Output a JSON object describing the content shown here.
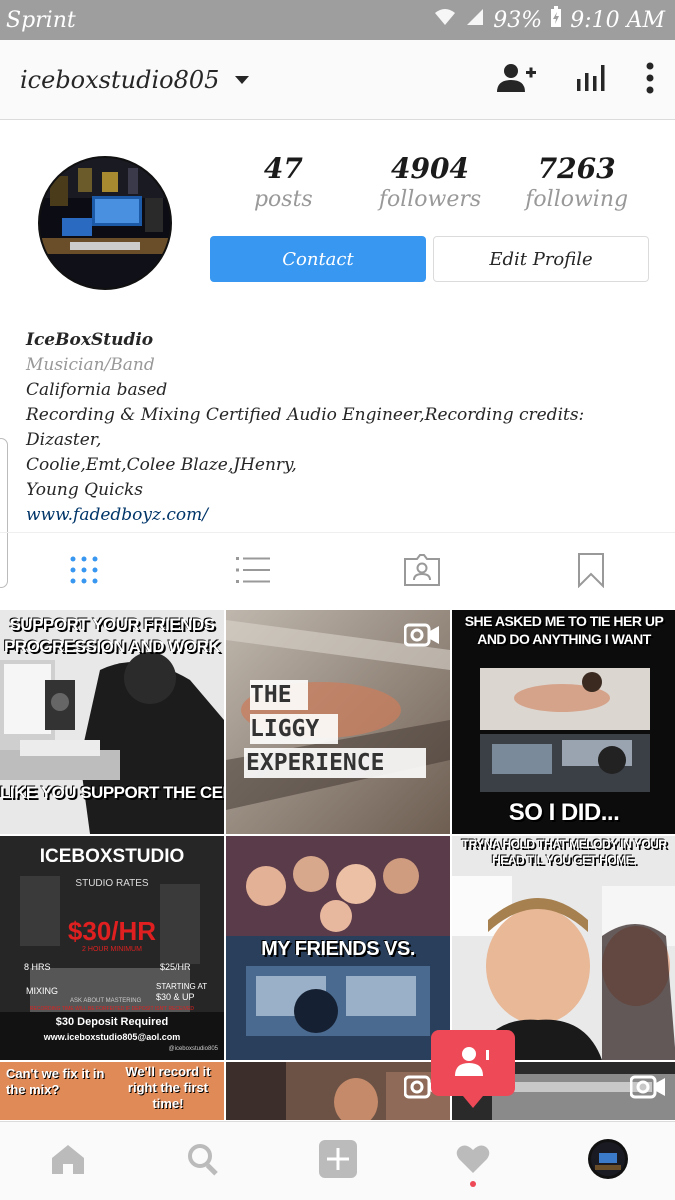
{
  "status_bar": {
    "carrier": "Sprint",
    "battery": "93%",
    "time": "9:10 AM"
  },
  "header": {
    "username": "iceboxstudio805",
    "icons": [
      "add-user-icon",
      "insights-icon",
      "more-options-icon"
    ]
  },
  "profile": {
    "stats": [
      {
        "value": "47",
        "label": "posts"
      },
      {
        "value": "4904",
        "label": "followers"
      },
      {
        "value": "7263",
        "label": "following"
      }
    ],
    "contact_label": "Contact",
    "edit_label": "Edit Profile"
  },
  "bio": {
    "name": "IceBoxStudio",
    "category": "Musician/Band",
    "line1": "California based",
    "line2": "Recording & Mixing Certified Audio Engineer,Recording credits: Dizaster,",
    "line3": "Coolie,Emt,Colee Blaze,JHenry,",
    "line4": "Young Quicks",
    "website": "www.fadedboyz.com/"
  },
  "tabs": [
    "grid-view-icon",
    "list-view-icon",
    "tagged-photos-icon",
    "saved-icon"
  ],
  "posts": [
    {
      "top": "SUPPORT YOUR FRIENDS PROGRESSION AND WORK",
      "bottom": "LIKE YOU SUPPORT THE CELEBRITIES THAT YOU DONT KN"
    },
    {
      "lines": [
        "THE",
        "LIGGY",
        "EXPERIENCE"
      ]
    },
    {
      "top": "SHE ASKED ME TO TIE HER UP AND DO ANYTHING I WANT",
      "bottom": "SO I DID..."
    },
    {
      "title": "ICEBOXSTUDIO",
      "sub": "STUDIO RATES",
      "price": "$30/HR",
      "price_note": "2 HOUR MINIMUM",
      "rate1": "8 HRS",
      "rate2": "$25/HR",
      "mixing": "MIXING",
      "ask": "ASK ABOUT MASTERING",
      "starting": "STARTING AT",
      "starting_val": "$30 & UP",
      "fine_print": "RECORDING TIME WILL BE FORFEITED IF DEPOSIT ISN'T RECEIVED",
      "deposit": "$30  Deposit  Required",
      "email": "www.iceboxstudio805@aol.com",
      "handle": "@iceboxstudio805"
    },
    {
      "caption": "MY FRIENDS  VS."
    },
    {
      "top": "TRYNA HOLD THAT  MELODY IN YOUR HEAD TIL YOU GET HOME."
    },
    {
      "left": "Can't we fix it in the mix?",
      "right": "We'll record it right the first time!"
    },
    {},
    {}
  ],
  "bottom_nav": [
    "home-icon",
    "search-icon",
    "add-post-icon",
    "activity-heart-icon",
    "profile-avatar-icon"
  ],
  "colors": {
    "accent": "#3897f0",
    "notification": "#ed4956",
    "status_bar": "#9e9e9e"
  }
}
